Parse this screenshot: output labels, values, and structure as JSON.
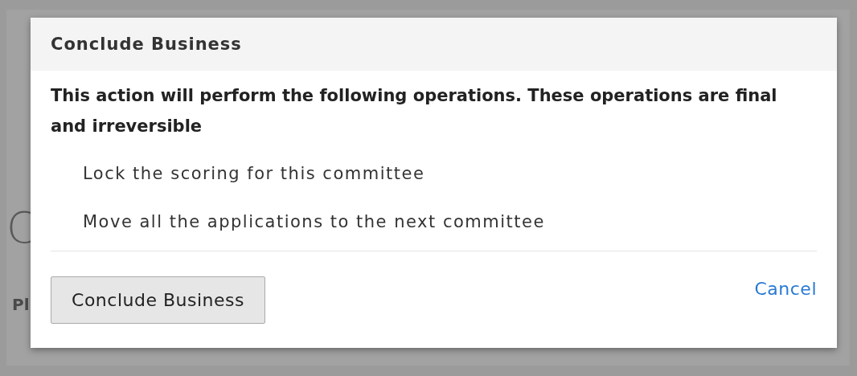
{
  "background": {
    "heading": "C",
    "label": "Pl"
  },
  "dialog": {
    "title": "Conclude Business",
    "message": "This action will perform the following operations. These operations are final and irreversible",
    "operations": [
      "Lock the scoring for this committee",
      "Move all the applications to the next committee"
    ],
    "confirm_button": "Conclude Business",
    "cancel_link": "Cancel"
  }
}
